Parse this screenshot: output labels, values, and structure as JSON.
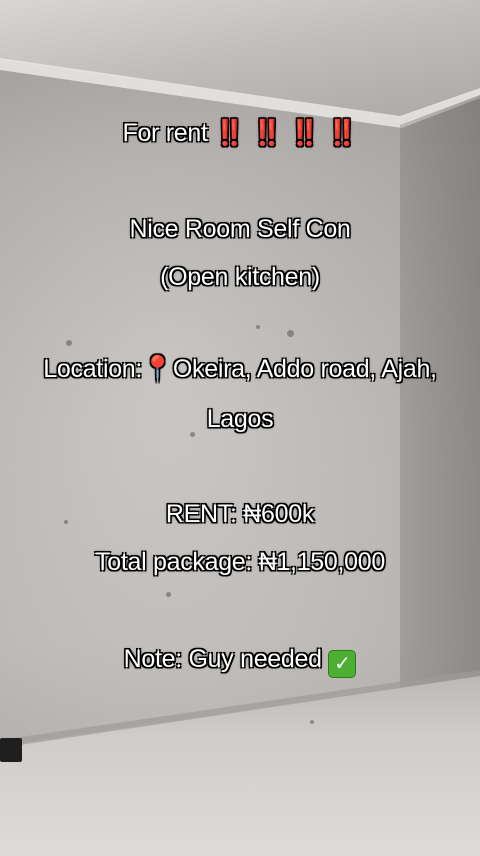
{
  "post": {
    "line1_text": "For rent",
    "line1_emoji": "‼️ ‼️ ‼️ ‼️",
    "line2": "Nice Room Self Con",
    "line3": "(Open kitchen)",
    "line4_label": "Location:",
    "line4_pin": "📍",
    "line4_text": "Okeira, Addo road, Ajah,",
    "line5": "Lagos",
    "line6": "RENT: ₦600k",
    "line7": "Total package: ₦1,150,000",
    "line8_text": "Note: Guy needed",
    "line8_check": "✓"
  }
}
